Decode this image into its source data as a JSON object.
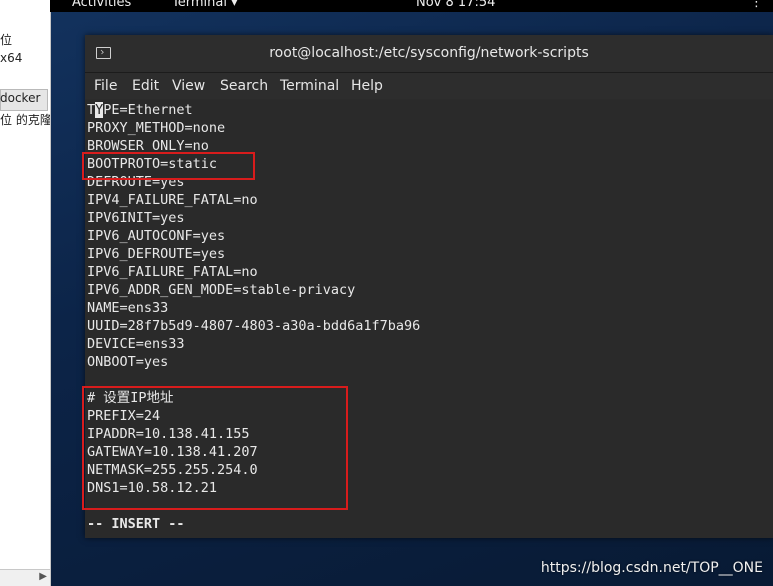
{
  "left_panel": {
    "lines": [
      "位",
      "x64",
      "docker",
      "位 的克隆"
    ]
  },
  "topbar": {
    "activities": "Activities",
    "terminal_menu": "Terminal ▾",
    "clock": "Nov 8  17:54",
    "tray": "⋮"
  },
  "window": {
    "title": "root@localhost:/etc/sysconfig/network-scripts"
  },
  "menubar": [
    "File",
    "Edit",
    "View",
    "Search",
    "Terminal",
    "Help"
  ],
  "editor": {
    "first_line": {
      "pre": "T",
      "cursor": "Y",
      "post": "PE=Ethernet"
    },
    "lines": [
      "PROXY_METHOD=none",
      "BROWSER_ONLY=no",
      "BOOTPROTO=static",
      "DEFROUTE=yes",
      "IPV4_FAILURE_FATAL=no",
      "IPV6INIT=yes",
      "IPV6_AUTOCONF=yes",
      "IPV6_DEFROUTE=yes",
      "IPV6_FAILURE_FATAL=no",
      "IPV6_ADDR_GEN_MODE=stable-privacy",
      "NAME=ens33",
      "UUID=28f7b5d9-4807-4803-a30a-bdd6a1f7ba96",
      "DEVICE=ens33",
      "ONBOOT=yes",
      "",
      "# 设置IP地址",
      "PREFIX=24",
      "IPADDR=10.138.41.155",
      "GATEWAY=10.138.41.207",
      "NETMASK=255.255.254.0",
      "DNS1=10.58.12.21"
    ],
    "mode": "-- INSERT --"
  },
  "colors": {
    "highlight_box": "#d81c1c",
    "terminal_bg": "#2a2a2a",
    "terminal_fg": "#e8e8e8"
  },
  "watermark": "https://blog.csdn.net/TOP__ONE"
}
